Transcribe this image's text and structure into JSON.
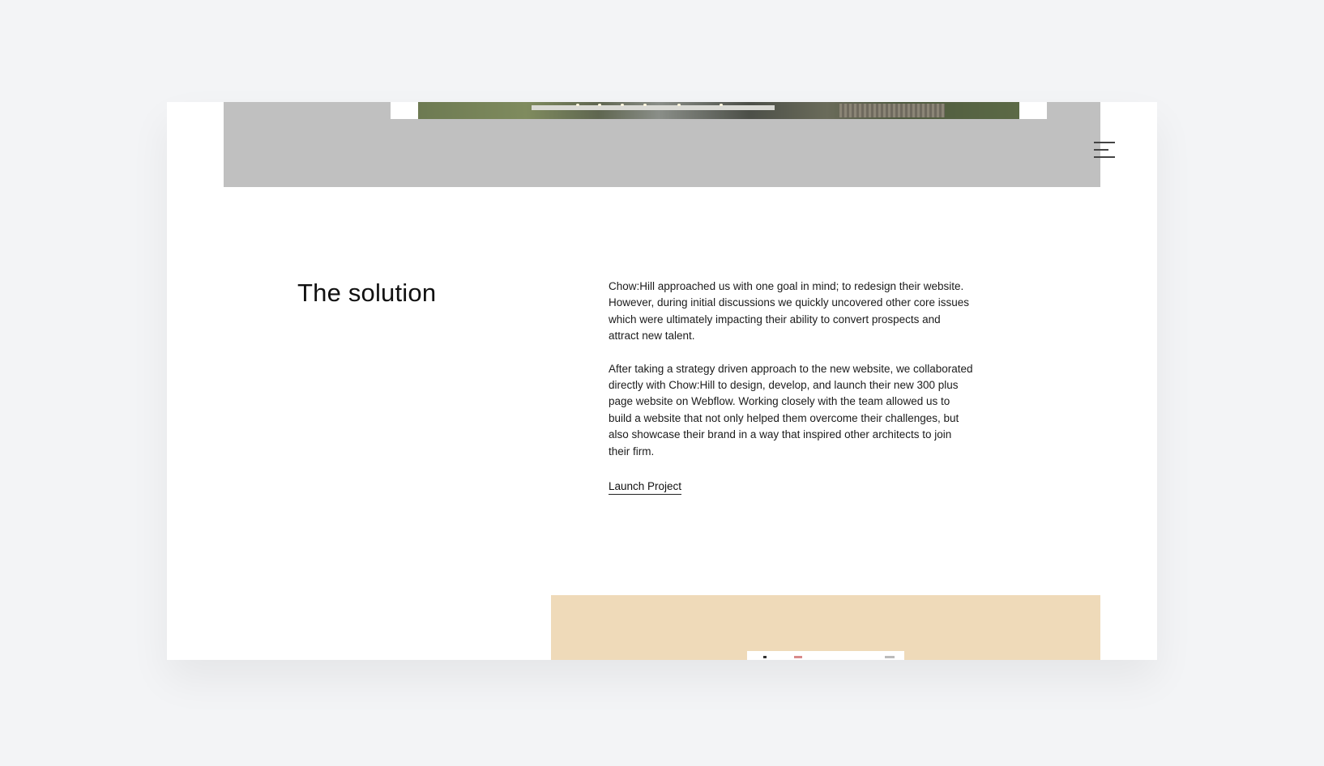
{
  "hero": {
    "image_alt": "Architecture photo: house with deck and lawn"
  },
  "nav": {
    "menu_icon": "hamburger-icon"
  },
  "solution": {
    "title": "The solution",
    "paragraph_1": "Chow:Hill approached us with one goal in mind; to redesign their website. However, during initial discussions we quickly uncovered other core issues which were ultimately impacting their ability to convert prospects and attract new talent.",
    "paragraph_2": "After taking a strategy driven approach to the new website, we collaborated directly with Chow:Hill to design, develop, and launch their new 300 plus page website on Webflow. Working closely with the team allowed us to build a website that not only helped them overcome their challenges, but also showcase their brand in a way that inspired other architects to join their firm.",
    "launch_label": "Launch Project"
  },
  "colors": {
    "page_background": "#f3f4f6",
    "hero_band": "#c0c0c0",
    "next_band": "#efdab9"
  }
}
